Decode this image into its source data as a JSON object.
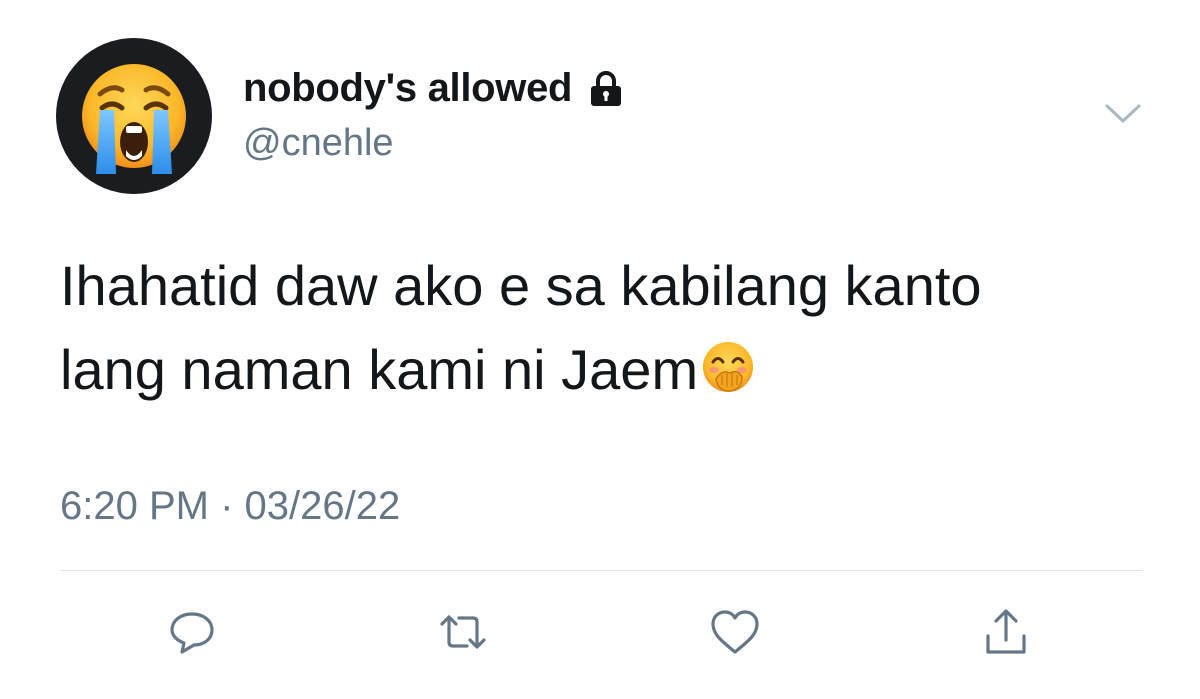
{
  "user": {
    "display_name": "nobody's allowed",
    "handle": "@cnehle",
    "avatar_icon": "loudly-crying-face-emoji",
    "protected_icon": "lock-icon"
  },
  "tweet": {
    "text_lines": [
      "Ihahatid daw ako e sa kabilang kanto",
      "lang naman kami ni Jaem"
    ],
    "trailing_emoji": "face-with-hand-over-mouth-emoji",
    "timestamp": "6:20 PM · 03/26/22"
  },
  "actions": [
    {
      "name": "reply",
      "icon": "reply-icon"
    },
    {
      "name": "retweet",
      "icon": "retweet-icon"
    },
    {
      "name": "like",
      "icon": "heart-icon"
    },
    {
      "name": "share",
      "icon": "share-icon"
    }
  ],
  "colors": {
    "text_primary": "#14171a",
    "text_secondary": "#657786",
    "icon": "#657786",
    "divider": "#dfe3e6",
    "avatar_bg": "#1a1c1f"
  }
}
